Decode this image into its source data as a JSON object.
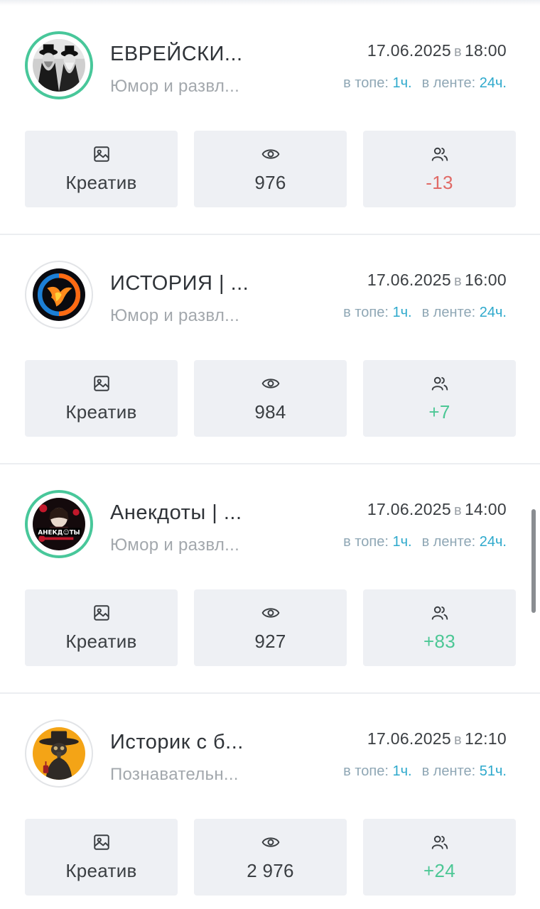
{
  "colors": {
    "accent_teal": "#2ea9cc",
    "positive": "#4cc795",
    "negative": "#e06a66",
    "ring_green": "#48c79a",
    "tile_bg": "#eef0f4"
  },
  "date_separator": "в",
  "label_top": "в топе:",
  "label_feed": "в ленте:",
  "cards": [
    {
      "title": "ЕВРЕЙСКИ...",
      "category": "Юмор и развл...",
      "date": "17.06.2025",
      "time": "18:00",
      "top_val": "1ч.",
      "feed_val": "24ч.",
      "creative_label": "Креатив",
      "views": "976",
      "subs": "-13",
      "subs_sign": "negative",
      "avatar_icon": "two-rabbis-photo"
    },
    {
      "title": "ИСТОРИЯ | ...",
      "category": "Юмор и развл...",
      "date": "17.06.2025",
      "time": "16:00",
      "top_val": "1ч.",
      "feed_val": "24ч.",
      "creative_label": "Креатив",
      "views": "984",
      "subs": "+7",
      "subs_sign": "positive",
      "avatar_icon": "fire-phoenix-logo"
    },
    {
      "title": "Анекдоты | ...",
      "category": "Юмор и развл...",
      "date": "17.06.2025",
      "time": "14:00",
      "top_val": "1ч.",
      "feed_val": "24ч.",
      "creative_label": "Креатив",
      "views": "927",
      "subs": "+83",
      "subs_sign": "positive",
      "avatar_icon": "anekdoty-logo",
      "avatar_text": "АНЕКД☺ТЫ"
    },
    {
      "title": "Историк с б...",
      "category": "Познавательн...",
      "date": "17.06.2025",
      "time": "12:10",
      "top_val": "1ч.",
      "feed_val": "51ч.",
      "creative_label": "Креатив",
      "views": "2 976",
      "subs": "+24",
      "subs_sign": "positive",
      "avatar_icon": "plague-doctor-illustration"
    }
  ]
}
